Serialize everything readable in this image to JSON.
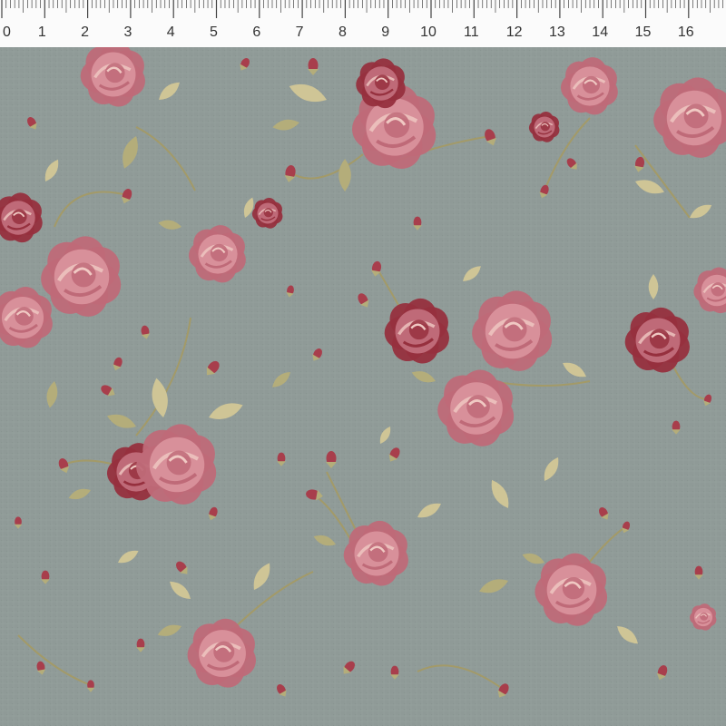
{
  "ruler": {
    "unit_labels": [
      "0",
      "1",
      "2",
      "3",
      "4",
      "5",
      "6",
      "7",
      "8",
      "9",
      "10",
      "11",
      "12",
      "13",
      "14",
      "15",
      "16"
    ]
  },
  "fabric": {
    "pattern": "vintage rose floral print",
    "colors": {
      "background": "#8f9a97",
      "rose_light": "#d8909a",
      "rose_mid": "#bf6a78",
      "rose_dark": "#96303e",
      "rose_highlight": "#f0c9c3",
      "leaf": "#b4ad7a",
      "leaf_light": "#cfc596",
      "stem": "#a39a68",
      "bud": "#a83e4c"
    }
  }
}
